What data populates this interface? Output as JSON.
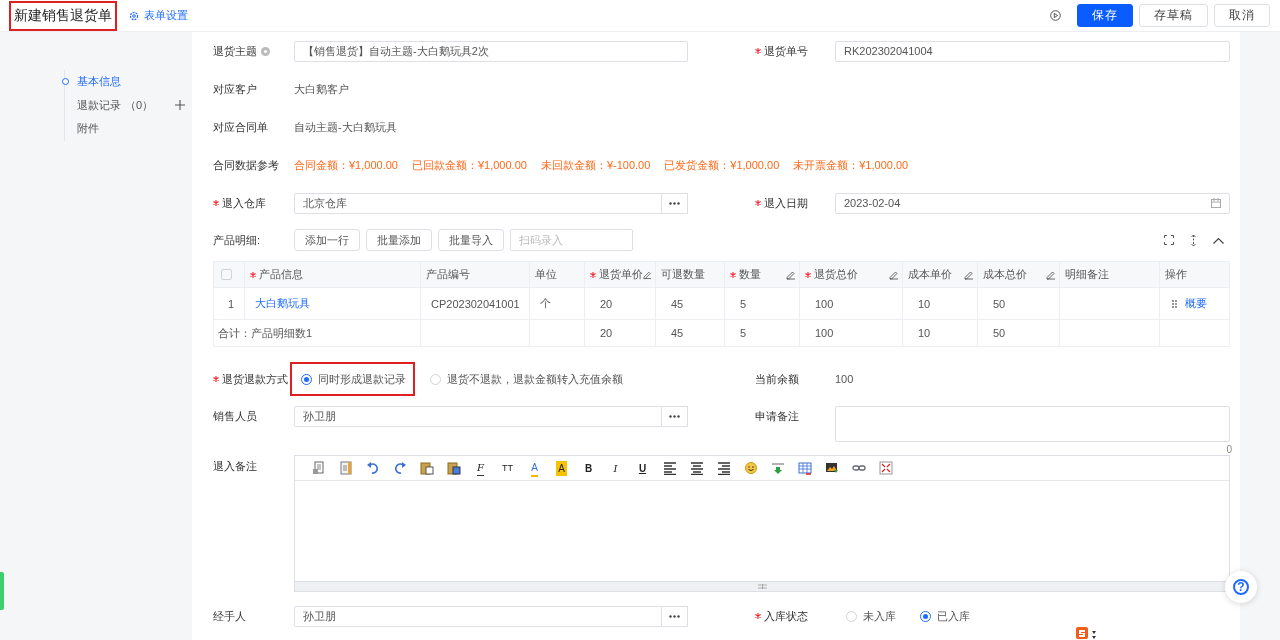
{
  "header": {
    "title": "新建销售退货单",
    "title_highlighted": true,
    "settings_link": "表单设置",
    "buttons": [
      {
        "label": "保存",
        "kind": "primary"
      },
      {
        "label": "存草稿",
        "kind": "default"
      },
      {
        "label": "取消",
        "kind": "default"
      }
    ]
  },
  "nav": {
    "items": [
      {
        "label": "基本信息",
        "selected": true
      },
      {
        "label": "退款记录",
        "count": "（0）",
        "addable": true,
        "selected": false
      },
      {
        "label": "附件",
        "selected": false
      }
    ]
  },
  "form": {
    "rows_top": [
      {
        "fields": [
          {
            "kind": "input",
            "label": "退货主题",
            "required": false,
            "help": true,
            "value": "【销售退货】自动主题-大白鹅玩具2次"
          },
          {
            "kind": "input",
            "label": "退货单号",
            "required": true,
            "value": "RK202302041004"
          }
        ]
      },
      {
        "fields": [
          {
            "kind": "text",
            "label": "对应客户",
            "required": false,
            "value": "大白鹅客户"
          }
        ]
      },
      {
        "fields": [
          {
            "kind": "text",
            "label": "对应合同单",
            "required": false,
            "value": "自动主题-大白鹅玩具"
          }
        ]
      },
      {
        "fields": [
          {
            "kind": "amounts",
            "label": "合同数据参考",
            "required": false,
            "items": [
              "合同金额：¥1,000.00",
              "已回款金额：¥1,000.00",
              "未回款金额：¥-100.00",
              "已发货金额：¥1,000.00",
              "未开票金额：¥1,000.00"
            ]
          }
        ]
      },
      {
        "fields": [
          {
            "kind": "picker",
            "label": "退入仓库",
            "required": true,
            "value": "北京仓库"
          },
          {
            "kind": "date",
            "label": "退入日期",
            "required": true,
            "value": "2023-02-04"
          }
        ]
      }
    ],
    "products": {
      "label": "产品明细:",
      "buttons": [
        "添加一行",
        "批量添加",
        "批量导入"
      ],
      "scan_placeholder": "扫码录入",
      "columns": [
        {
          "kind": "checkbox",
          "checked": false
        },
        {
          "kind": "link",
          "title": "产品信息",
          "required": true,
          "editable": false
        },
        {
          "kind": "text",
          "title": "产品编号",
          "required": false,
          "editable": false
        },
        {
          "kind": "text",
          "title": "单位",
          "required": false,
          "editable": false
        },
        {
          "kind": "number",
          "title": "退货单价",
          "required": true,
          "editable": true,
          "total": "20"
        },
        {
          "kind": "number",
          "title": "可退数量",
          "required": false,
          "editable": false,
          "total": "45"
        },
        {
          "kind": "number",
          "title": "数量",
          "required": true,
          "editable": true,
          "total": "5"
        },
        {
          "kind": "number",
          "title": "退货总价",
          "required": true,
          "editable": true,
          "total": "100"
        },
        {
          "kind": "number",
          "title": "成本单价",
          "required": false,
          "editable": true,
          "total": "10"
        },
        {
          "kind": "number",
          "title": "成本总价",
          "required": false,
          "editable": true,
          "total": "50"
        },
        {
          "kind": "text",
          "title": "明细备注",
          "required": false,
          "editable": false
        },
        {
          "kind": "action",
          "title": "操作",
          "required": false,
          "editable": false
        }
      ],
      "rows": [
        {
          "cells": [
            "1",
            "大白鹅玩具",
            "CP202302041001",
            "个",
            "20",
            "45",
            "5",
            "100",
            "10",
            "50",
            null,
            "概要"
          ]
        }
      ],
      "summary_label": "合计：产品明细数1"
    },
    "rows_bottom": [
      {
        "fields": [
          {
            "kind": "radios",
            "label": "退货退款方式",
            "required": true,
            "options": [
              {
                "label": "同时形成退款记录",
                "selected": true,
                "highlighted": true
              },
              {
                "label": "退货不退款，退款金额转入充值余额",
                "selected": false,
                "highlighted": false
              }
            ]
          },
          {
            "kind": "text",
            "label": "当前余额",
            "required": false,
            "value": "100"
          }
        ]
      },
      {
        "fields": [
          {
            "kind": "picker",
            "label": "销售人员",
            "required": false,
            "value": "孙卫朋"
          },
          {
            "kind": "textarea",
            "label": "申请备注",
            "required": false,
            "counter": "0"
          }
        ]
      },
      {
        "fields": [
          {
            "kind": "editor",
            "label": "退入备注",
            "required": false,
            "toolbar": [
              {
                "kind": "icon"
              },
              {
                "kind": "icon"
              },
              {
                "kind": "icon"
              },
              {
                "kind": "icon"
              },
              {
                "kind": "icon"
              },
              {
                "kind": "icon"
              },
              {
                "kind": "font",
                "label": "F"
              },
              {
                "kind": "size",
                "label": "TT"
              },
              {
                "kind": "color",
                "label": "A"
              },
              {
                "kind": "highlight",
                "label": "A"
              },
              {
                "kind": "bold",
                "label": "B"
              },
              {
                "kind": "italic",
                "label": "I"
              },
              {
                "kind": "underline",
                "label": "U"
              },
              {
                "kind": "icon"
              },
              {
                "kind": "icon"
              },
              {
                "kind": "icon"
              },
              {
                "kind": "icon"
              },
              {
                "kind": "icon"
              },
              {
                "kind": "icon"
              },
              {
                "kind": "icon"
              },
              {
                "kind": "icon"
              },
              {
                "kind": "icon"
              }
            ]
          }
        ]
      },
      {
        "fields": [
          {
            "kind": "picker",
            "label": "经手人",
            "required": false,
            "value": "孙卫朋"
          },
          {
            "kind": "radios",
            "label": "入库状态",
            "required": true,
            "options": [
              {
                "label": "未入库",
                "selected": false,
                "highlighted": false
              },
              {
                "label": "已入库",
                "selected": true,
                "highlighted": false
              }
            ]
          }
        ]
      }
    ]
  },
  "help_button": "?"
}
